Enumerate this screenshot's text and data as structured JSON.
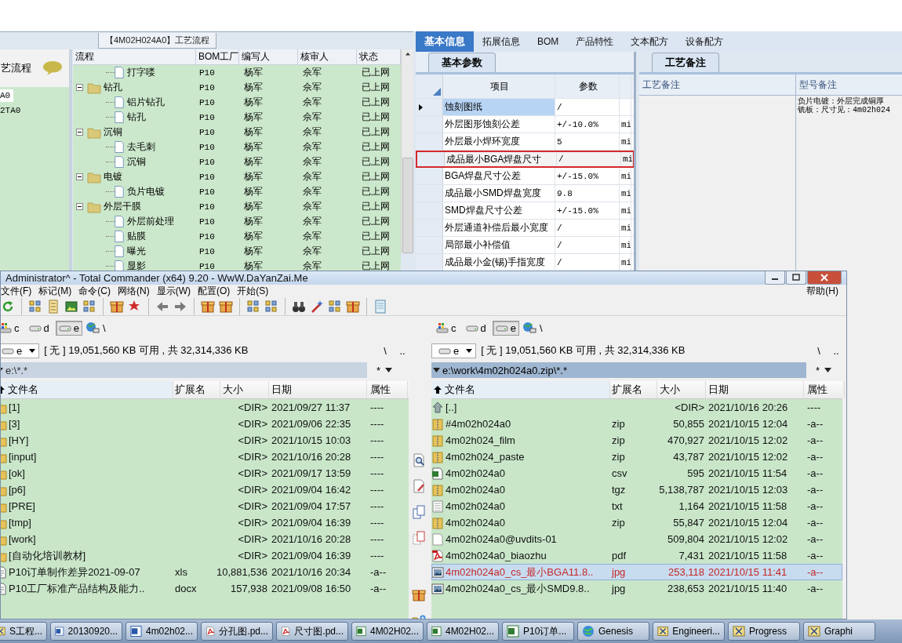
{
  "app": {
    "process": {
      "title": "【4M02H024A0】工艺流程",
      "sidebar": {
        "header": "艺流程",
        "items": [
          {
            "label": "A0",
            "selected": true
          },
          {
            "label": "2TA0",
            "selected": false
          }
        ]
      },
      "columns": [
        "流程",
        "BOM工厂",
        "编写人",
        "核审人",
        "状态"
      ],
      "steps": [
        {
          "kind": "step",
          "name": "打字喽",
          "bom": "P10",
          "writer": "杨军",
          "reviewer": "佘军",
          "status": "已上网"
        },
        {
          "kind": "group",
          "name": "钻孔",
          "expanded": true,
          "bom": "P10",
          "writer": "杨军",
          "reviewer": "佘军",
          "status": "已上网",
          "children": [
            {
              "kind": "step",
              "name": "铝片钻孔",
              "bom": "P10",
              "writer": "杨军",
              "reviewer": "佘军",
              "status": "已上网"
            },
            {
              "kind": "step",
              "name": "钻孔",
              "bom": "P10",
              "writer": "杨军",
              "reviewer": "佘军",
              "status": "已上网"
            }
          ]
        },
        {
          "kind": "group",
          "name": "沉铜",
          "expanded": true,
          "bom": "P10",
          "writer": "杨军",
          "reviewer": "佘军",
          "status": "已上网",
          "children": [
            {
              "kind": "step",
              "name": "去毛刺",
              "bom": "P10",
              "writer": "杨军",
              "reviewer": "佘军",
              "status": "已上网"
            },
            {
              "kind": "step",
              "name": "沉铜",
              "bom": "P10",
              "writer": "杨军",
              "reviewer": "佘军",
              "status": "已上网"
            }
          ]
        },
        {
          "kind": "group",
          "name": "电镀",
          "expanded": true,
          "bom": "P10",
          "writer": "杨军",
          "reviewer": "佘军",
          "status": "已上网",
          "children": [
            {
              "kind": "step",
              "name": "负片电镀",
              "bom": "P10",
              "writer": "杨军",
              "reviewer": "佘军",
              "status": "已上网"
            }
          ]
        },
        {
          "kind": "group",
          "name": "外层干膜",
          "expanded": true,
          "bom": "P10",
          "writer": "杨军",
          "reviewer": "佘军",
          "status": "已上网",
          "children": [
            {
              "kind": "step",
              "name": "外层前处理",
              "bom": "P10",
              "writer": "杨军",
              "reviewer": "佘军",
              "status": "已上网"
            },
            {
              "kind": "step",
              "name": "贴膜",
              "bom": "P10",
              "writer": "杨军",
              "reviewer": "佘军",
              "status": "已上网"
            },
            {
              "kind": "step",
              "name": "曝光",
              "bom": "P10",
              "writer": "杨军",
              "reviewer": "佘军",
              "status": "已上网"
            },
            {
              "kind": "step",
              "name": "显影",
              "bom": "P10",
              "writer": "杨军",
              "reviewer": "佘军",
              "status": "已上网"
            }
          ]
        }
      ]
    },
    "tabs": [
      {
        "label": "基本信息",
        "selected": true
      },
      {
        "label": "拓展信息",
        "selected": false
      },
      {
        "label": "BOM",
        "selected": false
      },
      {
        "label": "产品特性",
        "selected": false
      },
      {
        "label": "文本配方",
        "selected": false
      },
      {
        "label": "设备配方",
        "selected": false
      }
    ],
    "params": {
      "tab": "基本参数",
      "columns": [
        "项目",
        "参数"
      ],
      "rows": [
        {
          "item": "蚀刻图纸",
          "value": "/",
          "selected": true,
          "highlighted": false
        },
        {
          "item": "外层图形蚀刻公差",
          "value": "+/-10.0%",
          "unit": "mi",
          "selected": false,
          "highlighted": false
        },
        {
          "item": "外层最小焊环宽度",
          "value": "5",
          "unit": "mi",
          "selected": false,
          "highlighted": false
        },
        {
          "item": "成品最小BGA焊盘尺寸",
          "value": "/",
          "unit": "mi",
          "selected": false,
          "highlighted": true
        },
        {
          "item": "BGA焊盘尺寸公差",
          "value": "+/-15.0%",
          "unit": "mi",
          "selected": false,
          "highlighted": false
        },
        {
          "item": "成品最小SMD焊盘宽度",
          "value": "9.8",
          "unit": "mi",
          "selected": false,
          "highlighted": false
        },
        {
          "item": "SMD焊盘尺寸公差",
          "value": "+/-15.0%",
          "unit": "mi",
          "selected": false,
          "highlighted": false
        },
        {
          "item": "外层通道补偿后最小宽度",
          "value": "/",
          "unit": "mi",
          "selected": false,
          "highlighted": false
        },
        {
          "item": "局部最小补偿值",
          "value": "/",
          "unit": "mi",
          "selected": false,
          "highlighted": false
        },
        {
          "item": "成品最小金(锡)手指宽度",
          "value": "/",
          "unit": "mi",
          "selected": false,
          "highlighted": false
        }
      ]
    },
    "notes": {
      "tab": "工艺备注",
      "columns": [
        "工艺备注",
        "型号备注"
      ],
      "model_notes": [
        "负片电镀：外层完成铜厚",
        "铣板：尺寸见：4m02h024"
      ]
    }
  },
  "commander": {
    "title": "Administrator^ - Total Commander (x64) 9.20 - WwW.DaYanZai.Me",
    "menu": [
      "文件(F)",
      "标记(M)",
      "命令(C)",
      "网络(N)",
      "显示(W)",
      "配置(O)",
      "开始(S)"
    ],
    "help": "帮助(H)",
    "panels": [
      {
        "active": false,
        "drives": [
          {
            "letter": "c",
            "selected": false
          },
          {
            "letter": "d",
            "selected": false
          },
          {
            "letter": "e",
            "selected": true
          }
        ],
        "root": "\\",
        "drive": "e",
        "free_space": "[ 无 ] 19,051,560 KB 可用 , 共 32,314,336 KB",
        "backslash": "\\",
        "up": "..",
        "path": "e:\\*.*",
        "filter": "*",
        "columns": [
          "文件名",
          "扩展名",
          "大小",
          "日期",
          "属性"
        ],
        "files": [
          {
            "kind": "folder",
            "name": "[1]",
            "size": "<DIR>",
            "date": "2021/09/27 11:37",
            "attr": "----",
            "selected": false
          },
          {
            "kind": "folder",
            "name": "[3]",
            "size": "<DIR>",
            "date": "2021/09/06 22:35",
            "attr": "----",
            "selected": false
          },
          {
            "kind": "folder",
            "name": "[HY]",
            "size": "<DIR>",
            "date": "2021/10/15 10:03",
            "attr": "----",
            "selected": false
          },
          {
            "kind": "folder",
            "name": "[input]",
            "size": "<DIR>",
            "date": "2021/10/16 20:28",
            "attr": "----",
            "selected": false
          },
          {
            "kind": "folder",
            "name": "[ok]",
            "size": "<DIR>",
            "date": "2021/09/17 13:59",
            "attr": "----",
            "selected": false
          },
          {
            "kind": "folder",
            "name": "[p6]",
            "size": "<DIR>",
            "date": "2021/09/04 16:42",
            "attr": "----",
            "selected": false
          },
          {
            "kind": "folder",
            "name": "[PRE]",
            "size": "<DIR>",
            "date": "2021/09/04 17:57",
            "attr": "----",
            "selected": false
          },
          {
            "kind": "folder",
            "name": "[tmp]",
            "size": "<DIR>",
            "date": "2021/09/04 16:39",
            "attr": "----",
            "selected": false
          },
          {
            "kind": "folder",
            "name": "[work]",
            "size": "<DIR>",
            "date": "2021/10/16 20:28",
            "attr": "----",
            "selected": false
          },
          {
            "kind": "folder",
            "name": "[自动化培训教材]",
            "size": "<DIR>",
            "date": "2021/09/04 16:39",
            "attr": "----",
            "selected": false
          },
          {
            "kind": "doc",
            "name": "P10订单制作差异2021-09-07",
            "ext": "xls",
            "size": "10,881,536",
            "date": "2021/10/16 20:34",
            "attr": "-a--",
            "selected": false
          },
          {
            "kind": "doc",
            "name": "P10工厂标准产品结构及能力..",
            "ext": "docx",
            "size": "157,938",
            "date": "2021/09/08 16:50",
            "attr": "-a--",
            "selected": false
          }
        ]
      },
      {
        "active": true,
        "drives": [
          {
            "letter": "c",
            "selected": false
          },
          {
            "letter": "d",
            "selected": false
          },
          {
            "letter": "e",
            "selected": true
          }
        ],
        "root": "\\",
        "drive": "e",
        "free_space": "[ 无 ] 19,051,560 KB 可用 , 共 32,314,336 KB",
        "backslash": "\\",
        "up": "..",
        "path": "e:\\work\\4m02h024a0.zip\\*.*",
        "filter": "*",
        "columns": [
          "文件名",
          "扩展名",
          "大小",
          "日期",
          "属性"
        ],
        "files": [
          {
            "kind": "up",
            "name": "[..]",
            "size": "<DIR>",
            "date": "2021/10/16 20:26",
            "attr": "----",
            "selected": false
          },
          {
            "kind": "archive",
            "name": "#4m02h024a0",
            "ext": "zip",
            "size": "50,855",
            "date": "2021/10/15 12:04",
            "attr": "-a--",
            "selected": false
          },
          {
            "kind": "archive",
            "name": "4m02h024_film",
            "ext": "zip",
            "size": "470,927",
            "date": "2021/10/15 12:02",
            "attr": "-a--",
            "selected": false
          },
          {
            "kind": "archive",
            "name": "4m02h024_paste",
            "ext": "zip",
            "size": "43,787",
            "date": "2021/10/15 12:02",
            "attr": "-a--",
            "selected": false
          },
          {
            "kind": "sheet",
            "name": "4m02h024a0",
            "ext": "csv",
            "size": "595",
            "date": "2021/10/15 11:54",
            "attr": "-a--",
            "selected": false
          },
          {
            "kind": "archive",
            "name": "4m02h024a0",
            "ext": "tgz",
            "size": "5,138,787",
            "date": "2021/10/15 12:03",
            "attr": "-a--",
            "selected": false
          },
          {
            "kind": "text",
            "name": "4m02h024a0",
            "ext": "txt",
            "size": "1,164",
            "date": "2021/10/15 11:58",
            "attr": "-a--",
            "selected": false
          },
          {
            "kind": "archive",
            "name": "4m02h024a0",
            "ext": "zip",
            "size": "55,847",
            "date": "2021/10/15 12:04",
            "attr": "-a--",
            "selected": false
          },
          {
            "kind": "file",
            "name": "4m02h024a0@uvdits-01",
            "size": "509,804",
            "date": "2021/10/15 12:02",
            "attr": "-a--",
            "selected": false
          },
          {
            "kind": "pdf",
            "name": "4m02h024a0_biaozhu",
            "ext": "pdf",
            "size": "7,431",
            "date": "2021/10/15 11:58",
            "attr": "-a--",
            "selected": false
          },
          {
            "kind": "image",
            "name": "4m02h024a0_cs_最小BGA11.8..",
            "ext": "jpg",
            "size": "253,118",
            "date": "2021/10/15 11:41",
            "attr": "-a--",
            "selected": true
          },
          {
            "kind": "image",
            "name": "4m02h024a0_cs_最小SMD9.8..",
            "ext": "jpg",
            "size": "238,653",
            "date": "2021/10/15 11:40",
            "attr": "-a--",
            "selected": false
          }
        ]
      }
    ]
  },
  "taskbar": [
    {
      "kind": "app",
      "label": "S工程..."
    },
    {
      "kind": "word",
      "label": "20130920..."
    },
    {
      "kind": "word",
      "label": "4m02h02..."
    },
    {
      "kind": "pdf",
      "label": "分孔图.pd..."
    },
    {
      "kind": "pdf",
      "label": "尺寸图.pd..."
    },
    {
      "kind": "excel",
      "label": "4M02H02..."
    },
    {
      "kind": "excel",
      "label": "4M02H02..."
    },
    {
      "kind": "excel",
      "label": "P10订单..."
    },
    {
      "kind": "globe",
      "label": "Genesis"
    },
    {
      "kind": "app",
      "label": "Engineeri..."
    },
    {
      "kind": "app",
      "label": "Progress"
    },
    {
      "kind": "app",
      "label": "Graphi"
    }
  ]
}
